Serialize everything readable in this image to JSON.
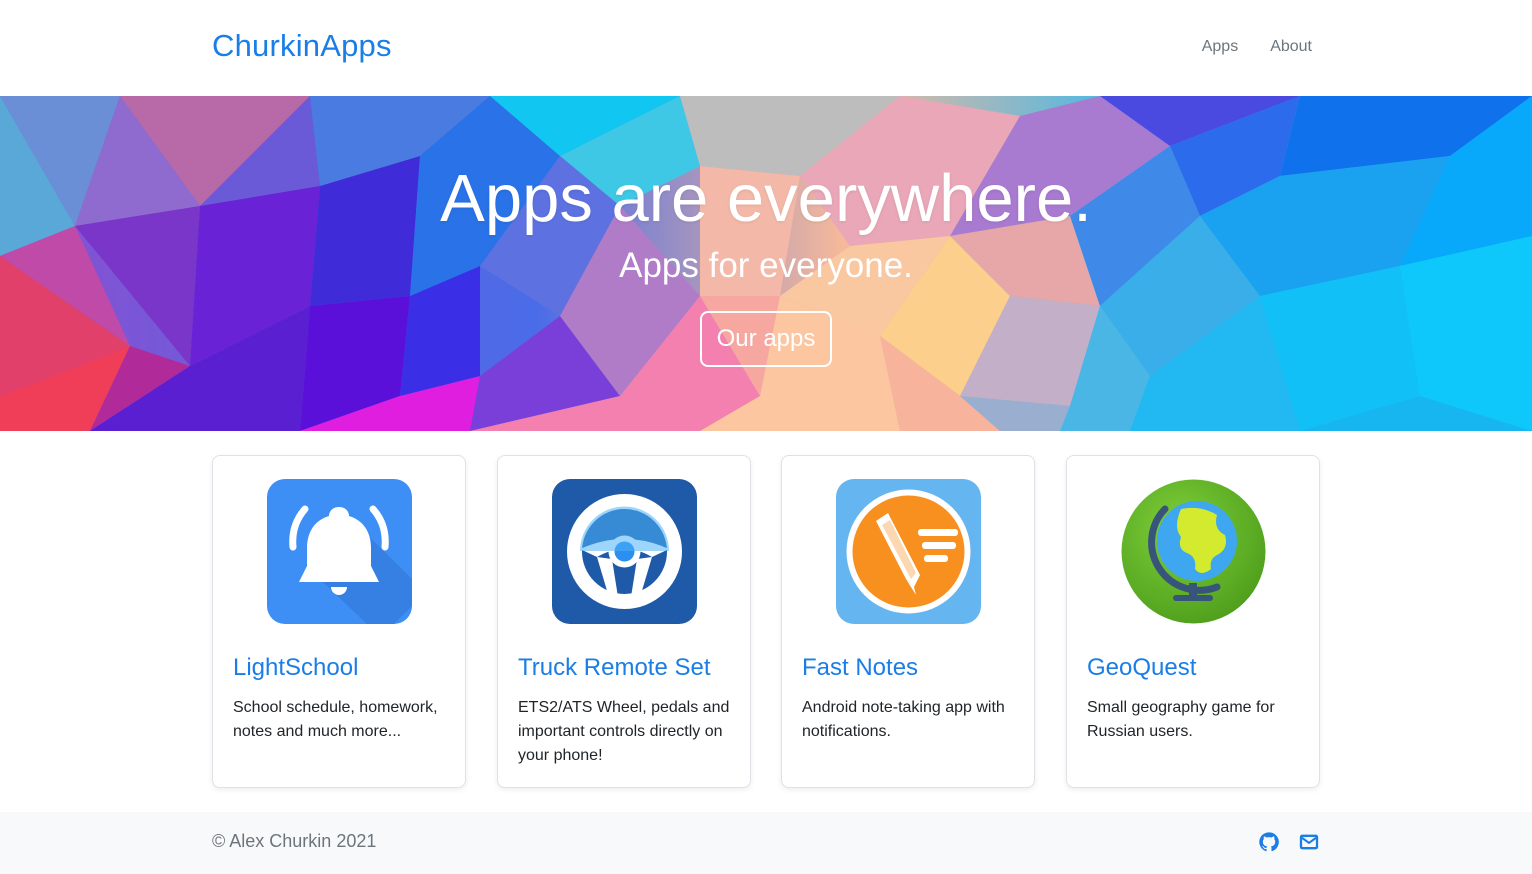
{
  "navbar": {
    "brand": "ChurkinApps",
    "links": [
      {
        "label": "Apps"
      },
      {
        "label": "About"
      }
    ]
  },
  "hero": {
    "title": "Apps are everywhere.",
    "subtitle": "Apps for everyone.",
    "button_label": "Our apps"
  },
  "apps": [
    {
      "name": "LightSchool",
      "description": "School schedule, homework, notes and much more...",
      "icon": "bell-icon",
      "icon_bg": "#3d8ef5"
    },
    {
      "name": "Truck Remote Set",
      "description": "ETS2/ATS Wheel, pedals and important controls directly on your phone!",
      "icon": "steering-wheel-icon",
      "icon_bg": "#1e5aa8"
    },
    {
      "name": "Fast Notes",
      "description": "Android note-taking app with notifications.",
      "icon": "note-pencil-icon",
      "icon_bg": "#64b5f0"
    },
    {
      "name": "GeoQuest",
      "description": "Small geography game for Russian users.",
      "icon": "globe-icon",
      "icon_bg": "#6dbb2f"
    }
  ],
  "footer": {
    "copyright": "© Alex Churkin 2021",
    "icons": [
      "github-icon",
      "envelope-icon"
    ]
  },
  "colors": {
    "brand": "#1a7ee6",
    "muted": "#6c757d",
    "footer_bg": "#f8f9fa"
  }
}
